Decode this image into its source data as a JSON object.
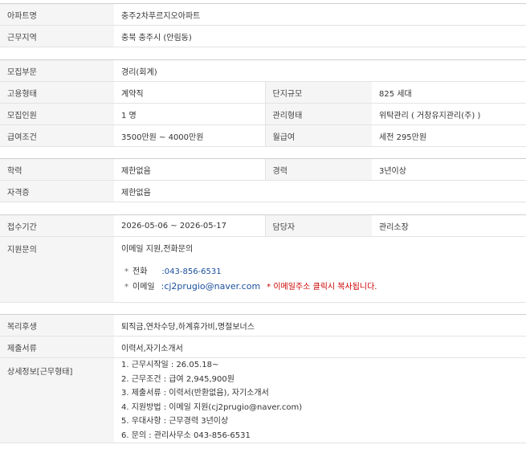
{
  "section1": {
    "rows": [
      {
        "label": "아파트명",
        "value": "충주2차푸르지오아파트"
      },
      {
        "label": "근무지역",
        "value": "충북 충주시 (안림동)"
      }
    ]
  },
  "section2": {
    "field_label": "모집부문",
    "field_value": "경리(회계)",
    "employment_label": "고용형태",
    "employment_value": "계약직",
    "complex_label": "단지규모",
    "complex_value": "825 세대",
    "headcount_label": "모집인원",
    "headcount_value": "1 명",
    "mgmt_label": "관리형태",
    "mgmt_value": "위탁관리 ( 거창유지관리(주) )",
    "salary_label": "급여조건",
    "salary_value": "3500만원 ~ 4000만원",
    "monthly_label": "월급여",
    "monthly_value": "세전 295만원"
  },
  "section3": {
    "edu_label": "학력",
    "edu_value": "제한없음",
    "career_label": "경력",
    "career_value": "3년이상",
    "cert_label": "자격증",
    "cert_value": "제한없음"
  },
  "section4": {
    "period_label": "접수기간",
    "period_value": "2026-05-06 ~ 2026-05-17",
    "manager_label": "담당자",
    "manager_value": "관리소장",
    "inquiry_label": "지원문의",
    "inquiry_method": "이메일 지원,전화문의",
    "phone_label": "전화",
    "phone_value": ":043-856-6531",
    "email_label": "이메일",
    "email_value": ":cj2prugio@naver.com",
    "copy_note": "* 이메일주소 클릭시 복사됩니다.",
    "bullet": "*"
  },
  "section5": {
    "welfare_label": "복리후생",
    "welfare_value": "퇴직금,연차수당,하계휴가비,명절보너스",
    "docs_label": "제출서류",
    "docs_value": "이력서,자기소개서",
    "detail_label": "상세정보[근무형태]",
    "detail_items": [
      "1. 근무시작일 : 26.05.18~",
      "2. 근무조건 : 급여 2,945,900원",
      "3. 제출서류 : 이력서(반환없음), 자기소개서",
      "4. 지원방법 : 이메일 지원(cj2prugio@naver.com)",
      "5. 우대사항 : 근무경력 3년이상",
      "6. 문의 : 관리사무소 043-856-6531"
    ]
  }
}
